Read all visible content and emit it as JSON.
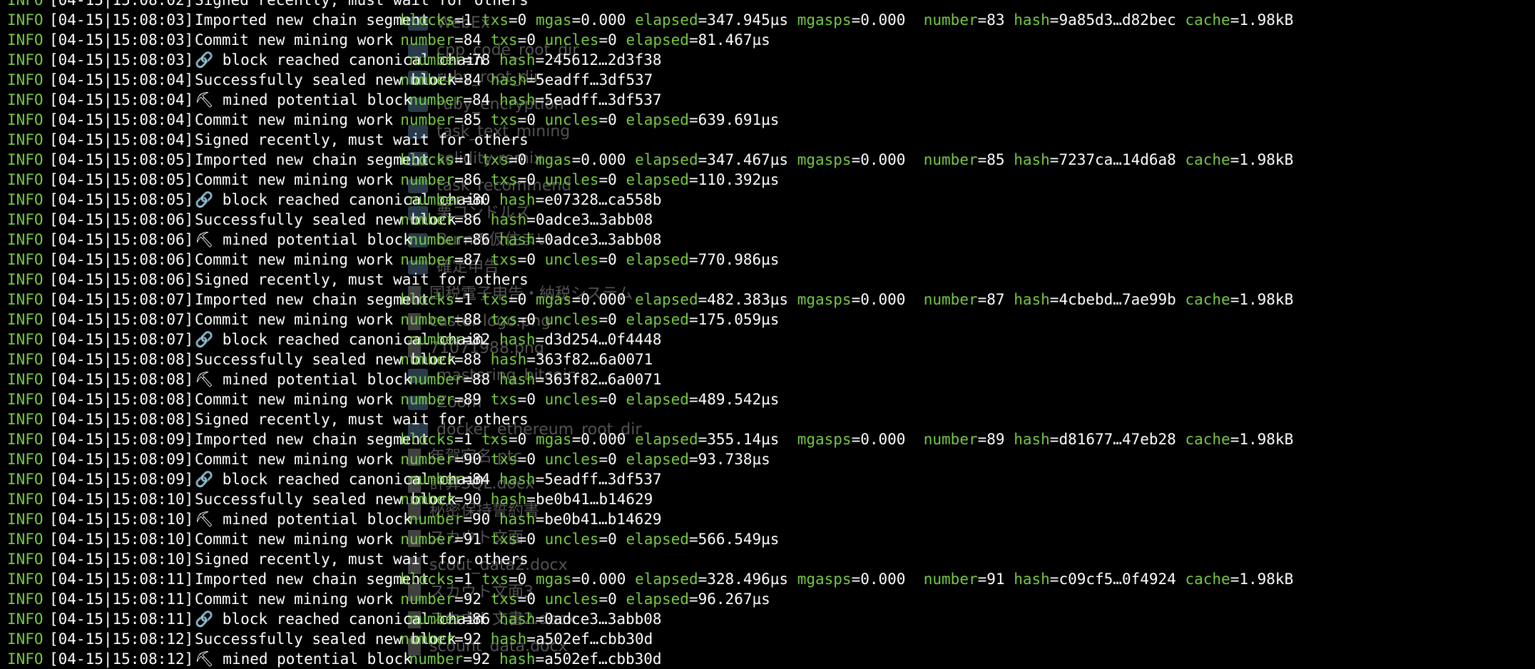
{
  "terminal": {
    "colors": {
      "background": "#000000",
      "level": "#76c942",
      "key": "#76c942",
      "text": "#ffffff"
    },
    "lines": [
      {
        "level": "INFO",
        "ts": "[04-15|15:08:02]",
        "msg": "Signed recently, must wait for others",
        "fields": []
      },
      {
        "level": "INFO",
        "ts": "[04-15|15:08:03]",
        "msg": "Imported new chain segment",
        "fields": [
          {
            "k": "blocks",
            "v": "1"
          },
          {
            "k": "txs",
            "v": "0"
          },
          {
            "k": "mgas",
            "v": "0.000"
          },
          {
            "k": "elapsed",
            "v": "347.945µs"
          },
          {
            "k": "mgasps",
            "v": "0.000 "
          },
          {
            "k": "number",
            "v": "83"
          },
          {
            "k": "hash",
            "v": "9a85d3…d82bec"
          },
          {
            "k": "cache",
            "v": "1.98kB"
          }
        ]
      },
      {
        "level": "INFO",
        "ts": "[04-15|15:08:03]",
        "msg": "Commit new mining work",
        "fields": [
          {
            "k": "number",
            "v": "84"
          },
          {
            "k": "txs",
            "v": "0"
          },
          {
            "k": "uncles",
            "v": "0"
          },
          {
            "k": "elapsed",
            "v": "81.467µs"
          }
        ]
      },
      {
        "level": "INFO",
        "ts": "[04-15|15:08:03]",
        "msg": "🔗 block reached canonical chain",
        "fields": [
          {
            "k": "number",
            "v": "78"
          },
          {
            "k": "hash",
            "v": "245612…2d3f38"
          }
        ]
      },
      {
        "level": "INFO",
        "ts": "[04-15|15:08:04]",
        "msg": "Successfully sealed new block",
        "fields": [
          {
            "k": "number",
            "v": "84"
          },
          {
            "k": "hash",
            "v": "5eadff…3df537"
          }
        ]
      },
      {
        "level": "INFO",
        "ts": "[04-15|15:08:04]",
        "msg": "⛏ mined potential block",
        "fields": [
          {
            "k": "number",
            "v": "84"
          },
          {
            "k": "hash",
            "v": "5eadff…3df537"
          }
        ]
      },
      {
        "level": "INFO",
        "ts": "[04-15|15:08:04]",
        "msg": "Commit new mining work",
        "fields": [
          {
            "k": "number",
            "v": "85"
          },
          {
            "k": "txs",
            "v": "0"
          },
          {
            "k": "uncles",
            "v": "0"
          },
          {
            "k": "elapsed",
            "v": "639.691µs"
          }
        ]
      },
      {
        "level": "INFO",
        "ts": "[04-15|15:08:04]",
        "msg": "Signed recently, must wait for others",
        "fields": []
      },
      {
        "level": "INFO",
        "ts": "[04-15|15:08:05]",
        "msg": "Imported new chain segment",
        "fields": [
          {
            "k": "blocks",
            "v": "1"
          },
          {
            "k": "txs",
            "v": "0"
          },
          {
            "k": "mgas",
            "v": "0.000"
          },
          {
            "k": "elapsed",
            "v": "347.467µs"
          },
          {
            "k": "mgasps",
            "v": "0.000 "
          },
          {
            "k": "number",
            "v": "85"
          },
          {
            "k": "hash",
            "v": "7237ca…14d6a8"
          },
          {
            "k": "cache",
            "v": "1.98kB"
          }
        ]
      },
      {
        "level": "INFO",
        "ts": "[04-15|15:08:05]",
        "msg": "Commit new mining work",
        "fields": [
          {
            "k": "number",
            "v": "86"
          },
          {
            "k": "txs",
            "v": "0"
          },
          {
            "k": "uncles",
            "v": "0"
          },
          {
            "k": "elapsed",
            "v": "110.392µs"
          }
        ]
      },
      {
        "level": "INFO",
        "ts": "[04-15|15:08:05]",
        "msg": "🔗 block reached canonical chain",
        "fields": [
          {
            "k": "number",
            "v": "80"
          },
          {
            "k": "hash",
            "v": "e07328…ca558b"
          }
        ]
      },
      {
        "level": "INFO",
        "ts": "[04-15|15:08:06]",
        "msg": "Successfully sealed new block",
        "fields": [
          {
            "k": "number",
            "v": "86"
          },
          {
            "k": "hash",
            "v": "0adce3…3abb08"
          }
        ]
      },
      {
        "level": "INFO",
        "ts": "[04-15|15:08:06]",
        "msg": "⛏ mined potential block",
        "fields": [
          {
            "k": "number",
            "v": "86"
          },
          {
            "k": "hash",
            "v": "0adce3…3abb08"
          }
        ]
      },
      {
        "level": "INFO",
        "ts": "[04-15|15:08:06]",
        "msg": "Commit new mining work",
        "fields": [
          {
            "k": "number",
            "v": "87"
          },
          {
            "k": "txs",
            "v": "0"
          },
          {
            "k": "uncles",
            "v": "0"
          },
          {
            "k": "elapsed",
            "v": "770.986µs"
          }
        ]
      },
      {
        "level": "INFO",
        "ts": "[04-15|15:08:06]",
        "msg": "Signed recently, must wait for others",
        "fields": []
      },
      {
        "level": "INFO",
        "ts": "[04-15|15:08:07]",
        "msg": "Imported new chain segment",
        "fields": [
          {
            "k": "blocks",
            "v": "1"
          },
          {
            "k": "txs",
            "v": "0"
          },
          {
            "k": "mgas",
            "v": "0.000"
          },
          {
            "k": "elapsed",
            "v": "482.383µs"
          },
          {
            "k": "mgasps",
            "v": "0.000 "
          },
          {
            "k": "number",
            "v": "87"
          },
          {
            "k": "hash",
            "v": "4cbebd…7ae99b"
          },
          {
            "k": "cache",
            "v": "1.98kB"
          }
        ]
      },
      {
        "level": "INFO",
        "ts": "[04-15|15:08:07]",
        "msg": "Commit new mining work",
        "fields": [
          {
            "k": "number",
            "v": "88"
          },
          {
            "k": "txs",
            "v": "0"
          },
          {
            "k": "uncles",
            "v": "0"
          },
          {
            "k": "elapsed",
            "v": "175.059µs"
          }
        ]
      },
      {
        "level": "INFO",
        "ts": "[04-15|15:08:07]",
        "msg": "🔗 block reached canonical chain",
        "fields": [
          {
            "k": "number",
            "v": "82"
          },
          {
            "k": "hash",
            "v": "d3d254…0f4448"
          }
        ]
      },
      {
        "level": "INFO",
        "ts": "[04-15|15:08:08]",
        "msg": "Successfully sealed new block",
        "fields": [
          {
            "k": "number",
            "v": "88"
          },
          {
            "k": "hash",
            "v": "363f82…6a0071"
          }
        ]
      },
      {
        "level": "INFO",
        "ts": "[04-15|15:08:08]",
        "msg": "⛏ mined potential block",
        "fields": [
          {
            "k": "number",
            "v": "88"
          },
          {
            "k": "hash",
            "v": "363f82…6a0071"
          }
        ]
      },
      {
        "level": "INFO",
        "ts": "[04-15|15:08:08]",
        "msg": "Commit new mining work",
        "fields": [
          {
            "k": "number",
            "v": "89"
          },
          {
            "k": "txs",
            "v": "0"
          },
          {
            "k": "uncles",
            "v": "0"
          },
          {
            "k": "elapsed",
            "v": "489.542µs"
          }
        ]
      },
      {
        "level": "INFO",
        "ts": "[04-15|15:08:08]",
        "msg": "Signed recently, must wait for others",
        "fields": []
      },
      {
        "level": "INFO",
        "ts": "[04-15|15:08:09]",
        "msg": "Imported new chain segment",
        "fields": [
          {
            "k": "blocks",
            "v": "1"
          },
          {
            "k": "txs",
            "v": "0"
          },
          {
            "k": "mgas",
            "v": "0.000"
          },
          {
            "k": "elapsed",
            "v": "355.14µs "
          },
          {
            "k": "mgasps",
            "v": "0.000 "
          },
          {
            "k": "number",
            "v": "89"
          },
          {
            "k": "hash",
            "v": "d81677…47eb28"
          },
          {
            "k": "cache",
            "v": "1.98kB"
          }
        ]
      },
      {
        "level": "INFO",
        "ts": "[04-15|15:08:09]",
        "msg": "Commit new mining work",
        "fields": [
          {
            "k": "number",
            "v": "90"
          },
          {
            "k": "txs",
            "v": "0"
          },
          {
            "k": "uncles",
            "v": "0"
          },
          {
            "k": "elapsed",
            "v": "93.738µs"
          }
        ]
      },
      {
        "level": "INFO",
        "ts": "[04-15|15:08:09]",
        "msg": "🔗 block reached canonical chain",
        "fields": [
          {
            "k": "number",
            "v": "84"
          },
          {
            "k": "hash",
            "v": "5eadff…3df537"
          }
        ]
      },
      {
        "level": "INFO",
        "ts": "[04-15|15:08:10]",
        "msg": "Successfully sealed new block",
        "fields": [
          {
            "k": "number",
            "v": "90"
          },
          {
            "k": "hash",
            "v": "be0b41…b14629"
          }
        ]
      },
      {
        "level": "INFO",
        "ts": "[04-15|15:08:10]",
        "msg": "⛏ mined potential block",
        "fields": [
          {
            "k": "number",
            "v": "90"
          },
          {
            "k": "hash",
            "v": "be0b41…b14629"
          }
        ]
      },
      {
        "level": "INFO",
        "ts": "[04-15|15:08:10]",
        "msg": "Commit new mining work",
        "fields": [
          {
            "k": "number",
            "v": "91"
          },
          {
            "k": "txs",
            "v": "0"
          },
          {
            "k": "uncles",
            "v": "0"
          },
          {
            "k": "elapsed",
            "v": "566.549µs"
          }
        ]
      },
      {
        "level": "INFO",
        "ts": "[04-15|15:08:10]",
        "msg": "Signed recently, must wait for others",
        "fields": []
      },
      {
        "level": "INFO",
        "ts": "[04-15|15:08:11]",
        "msg": "Imported new chain segment",
        "fields": [
          {
            "k": "blocks",
            "v": "1"
          },
          {
            "k": "txs",
            "v": "0"
          },
          {
            "k": "mgas",
            "v": "0.000"
          },
          {
            "k": "elapsed",
            "v": "328.496µs"
          },
          {
            "k": "mgasps",
            "v": "0.000 "
          },
          {
            "k": "number",
            "v": "91"
          },
          {
            "k": "hash",
            "v": "c09cf5…0f4924"
          },
          {
            "k": "cache",
            "v": "1.98kB"
          }
        ]
      },
      {
        "level": "INFO",
        "ts": "[04-15|15:08:11]",
        "msg": "Commit new mining work",
        "fields": [
          {
            "k": "number",
            "v": "92"
          },
          {
            "k": "txs",
            "v": "0"
          },
          {
            "k": "uncles",
            "v": "0"
          },
          {
            "k": "elapsed",
            "v": "96.267µs"
          }
        ]
      },
      {
        "level": "INFO",
        "ts": "[04-15|15:08:11]",
        "msg": "🔗 block reached canonical chain",
        "fields": [
          {
            "k": "number",
            "v": "86"
          },
          {
            "k": "hash",
            "v": "0adce3…3abb08"
          }
        ]
      },
      {
        "level": "INFO",
        "ts": "[04-15|15:08:12]",
        "msg": "Successfully sealed new block",
        "fields": [
          {
            "k": "number",
            "v": "92"
          },
          {
            "k": "hash",
            "v": "a502ef…cbb30d"
          }
        ]
      },
      {
        "level": "INFO",
        "ts": "[04-15|15:08:12]",
        "msg": "⛏ mined potential block",
        "fields": [
          {
            "k": "number",
            "v": "92"
          },
          {
            "k": "hash",
            "v": "a502ef…cbb30d"
          }
        ]
      }
    ]
  },
  "background_finder": {
    "items": [
      {
        "label": "WebEx",
        "kind": "folder"
      },
      {
        "label": "cpp_code_root_dir",
        "kind": "folder"
      },
      {
        "label": "ruby_root_dir",
        "kind": "folder"
      },
      {
        "label": "ruby_encryption",
        "kind": "folder"
      },
      {
        "label": "task_text_mining",
        "kind": "folder"
      },
      {
        "label": "solidity-remix",
        "kind": "folder"
      },
      {
        "label": "task_recommend",
        "kind": "folder"
      },
      {
        "label": "栗コンドルズ",
        "kind": "folder"
      },
      {
        "label": "Burnの仮住まい",
        "kind": "folder"
      },
      {
        "label": "確定申告",
        "kind": "folder"
      },
      {
        "label": "国税電子申告・納税システム",
        "kind": "doc"
      },
      {
        "label": "caster-logo.png",
        "kind": "doc"
      },
      {
        "label": "71071988.png",
        "kind": "doc"
      },
      {
        "label": "mastering_bitcoin",
        "kind": "folder"
      },
      {
        "label": "Zoom",
        "kind": "folder"
      },
      {
        "label": "docker_ethereum_root_dir",
        "kind": "folder"
      },
      {
        "label": "年賀宛名.ptc",
        "kind": "doc"
      },
      {
        "label": "計算SQL.docx",
        "kind": "doc"
      },
      {
        "label": "秘密保持誓約書",
        "kind": "doc"
      },
      {
        "label": "スカウト文面",
        "kind": "doc"
      },
      {
        "label": "scout_data2.docx",
        "kind": "doc"
      },
      {
        "label": "スカウト文面3",
        "kind": "doc"
      },
      {
        "label": "スカウト文書2.docx",
        "kind": "doc"
      },
      {
        "label": "scount_data.docx",
        "kind": "doc"
      }
    ]
  }
}
